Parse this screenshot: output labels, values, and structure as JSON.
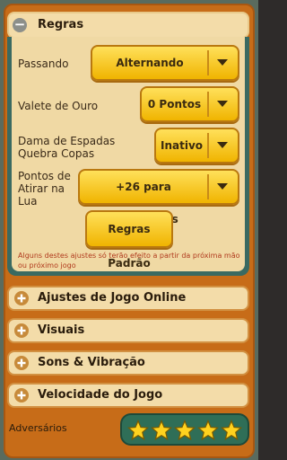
{
  "rules": {
    "title": "Regras",
    "rows": [
      {
        "label": "Passando",
        "value": "Alternando"
      },
      {
        "label": "Valete de Ouro",
        "value": "0 Pontos"
      },
      {
        "label": "Dama de Espadas Quebra Copas",
        "value": "Inativo"
      },
      {
        "label": "Pontos de Atirar na Lua",
        "value": "+26 para Perdedores"
      }
    ],
    "default_button": "Regras Padrão",
    "note": "Alguns destes ajustes só terão efeito a partir da próxima mão ou próximo jogo"
  },
  "sections": [
    {
      "title": "Ajustes de Jogo Online"
    },
    {
      "title": "Visuais"
    },
    {
      "title": "Sons & Vibração"
    },
    {
      "title": "Velocidade do Jogo"
    }
  ],
  "opponents": {
    "label": "Adversários",
    "stars": 5,
    "max_stars": 5
  },
  "icons": {
    "collapse": "minus-icon",
    "expand": "plus-icon",
    "dropdown": "chevron-down-icon",
    "rating": "star-icon"
  },
  "colors": {
    "frame": "#c76c18",
    "panel": "#f3dca9",
    "button": "#f5c518",
    "note": "#b03a1e",
    "stars_bg": "#2f6e57",
    "star": "#ffd21f"
  }
}
